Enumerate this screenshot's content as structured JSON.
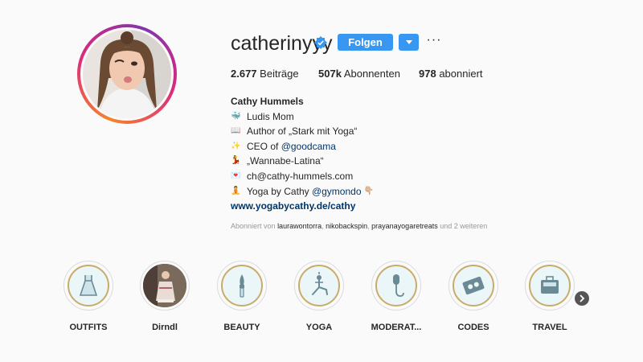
{
  "profile": {
    "username": "catherinyyy",
    "follow_label": "Folgen",
    "more_label": "···"
  },
  "stats": {
    "posts_count": "2.677",
    "posts_label": "Beiträge",
    "followers_count": "507k",
    "followers_label": "Abonnenten",
    "following_count": "978",
    "following_label": "abonniert"
  },
  "bio": {
    "name": "Cathy Hummels",
    "lines": [
      {
        "emoji": "🐳",
        "text": "Ludis Mom",
        "mention": ""
      },
      {
        "emoji": "📖",
        "text": "Author of „Stark mit Yoga“",
        "mention": ""
      },
      {
        "emoji": "✨",
        "text": "CEO of ",
        "mention": "@goodcama"
      },
      {
        "emoji": "💃",
        "text": "„Wannabe-Latina“",
        "mention": ""
      },
      {
        "emoji": "💌",
        "text": "ch@cathy-hummels.com",
        "mention": ""
      },
      {
        "emoji": "🧘",
        "text": "Yoga by Cathy ",
        "mention": "@gymondo",
        "trail": "👇🏼"
      }
    ],
    "website": "www.yogabycathy.de/cathy"
  },
  "followed_by": {
    "prefix": "Abonniert von",
    "users": [
      "laurawontorra",
      "nikobackspin",
      "prayanayogaretreats"
    ],
    "suffix": "und 2 weiteren"
  },
  "highlights": [
    {
      "label": "OUTFITS",
      "icon": "dress-icon"
    },
    {
      "label": "Dirndl",
      "icon": "photo-thumbnail"
    },
    {
      "label": "BEAUTY",
      "icon": "brush-icon"
    },
    {
      "label": "YOGA",
      "icon": "yoga-pose-icon"
    },
    {
      "label": "MODERAT...",
      "icon": "microphone-icon"
    },
    {
      "label": "CODES",
      "icon": "coupon-icon"
    },
    {
      "label": "TRAVEL",
      "icon": "suitcase-icon"
    }
  ],
  "colors": {
    "accent": "#3897f0",
    "highlight_gold": "#c9ac6a",
    "highlight_bg": "#eaf6f8",
    "link": "#003569"
  }
}
